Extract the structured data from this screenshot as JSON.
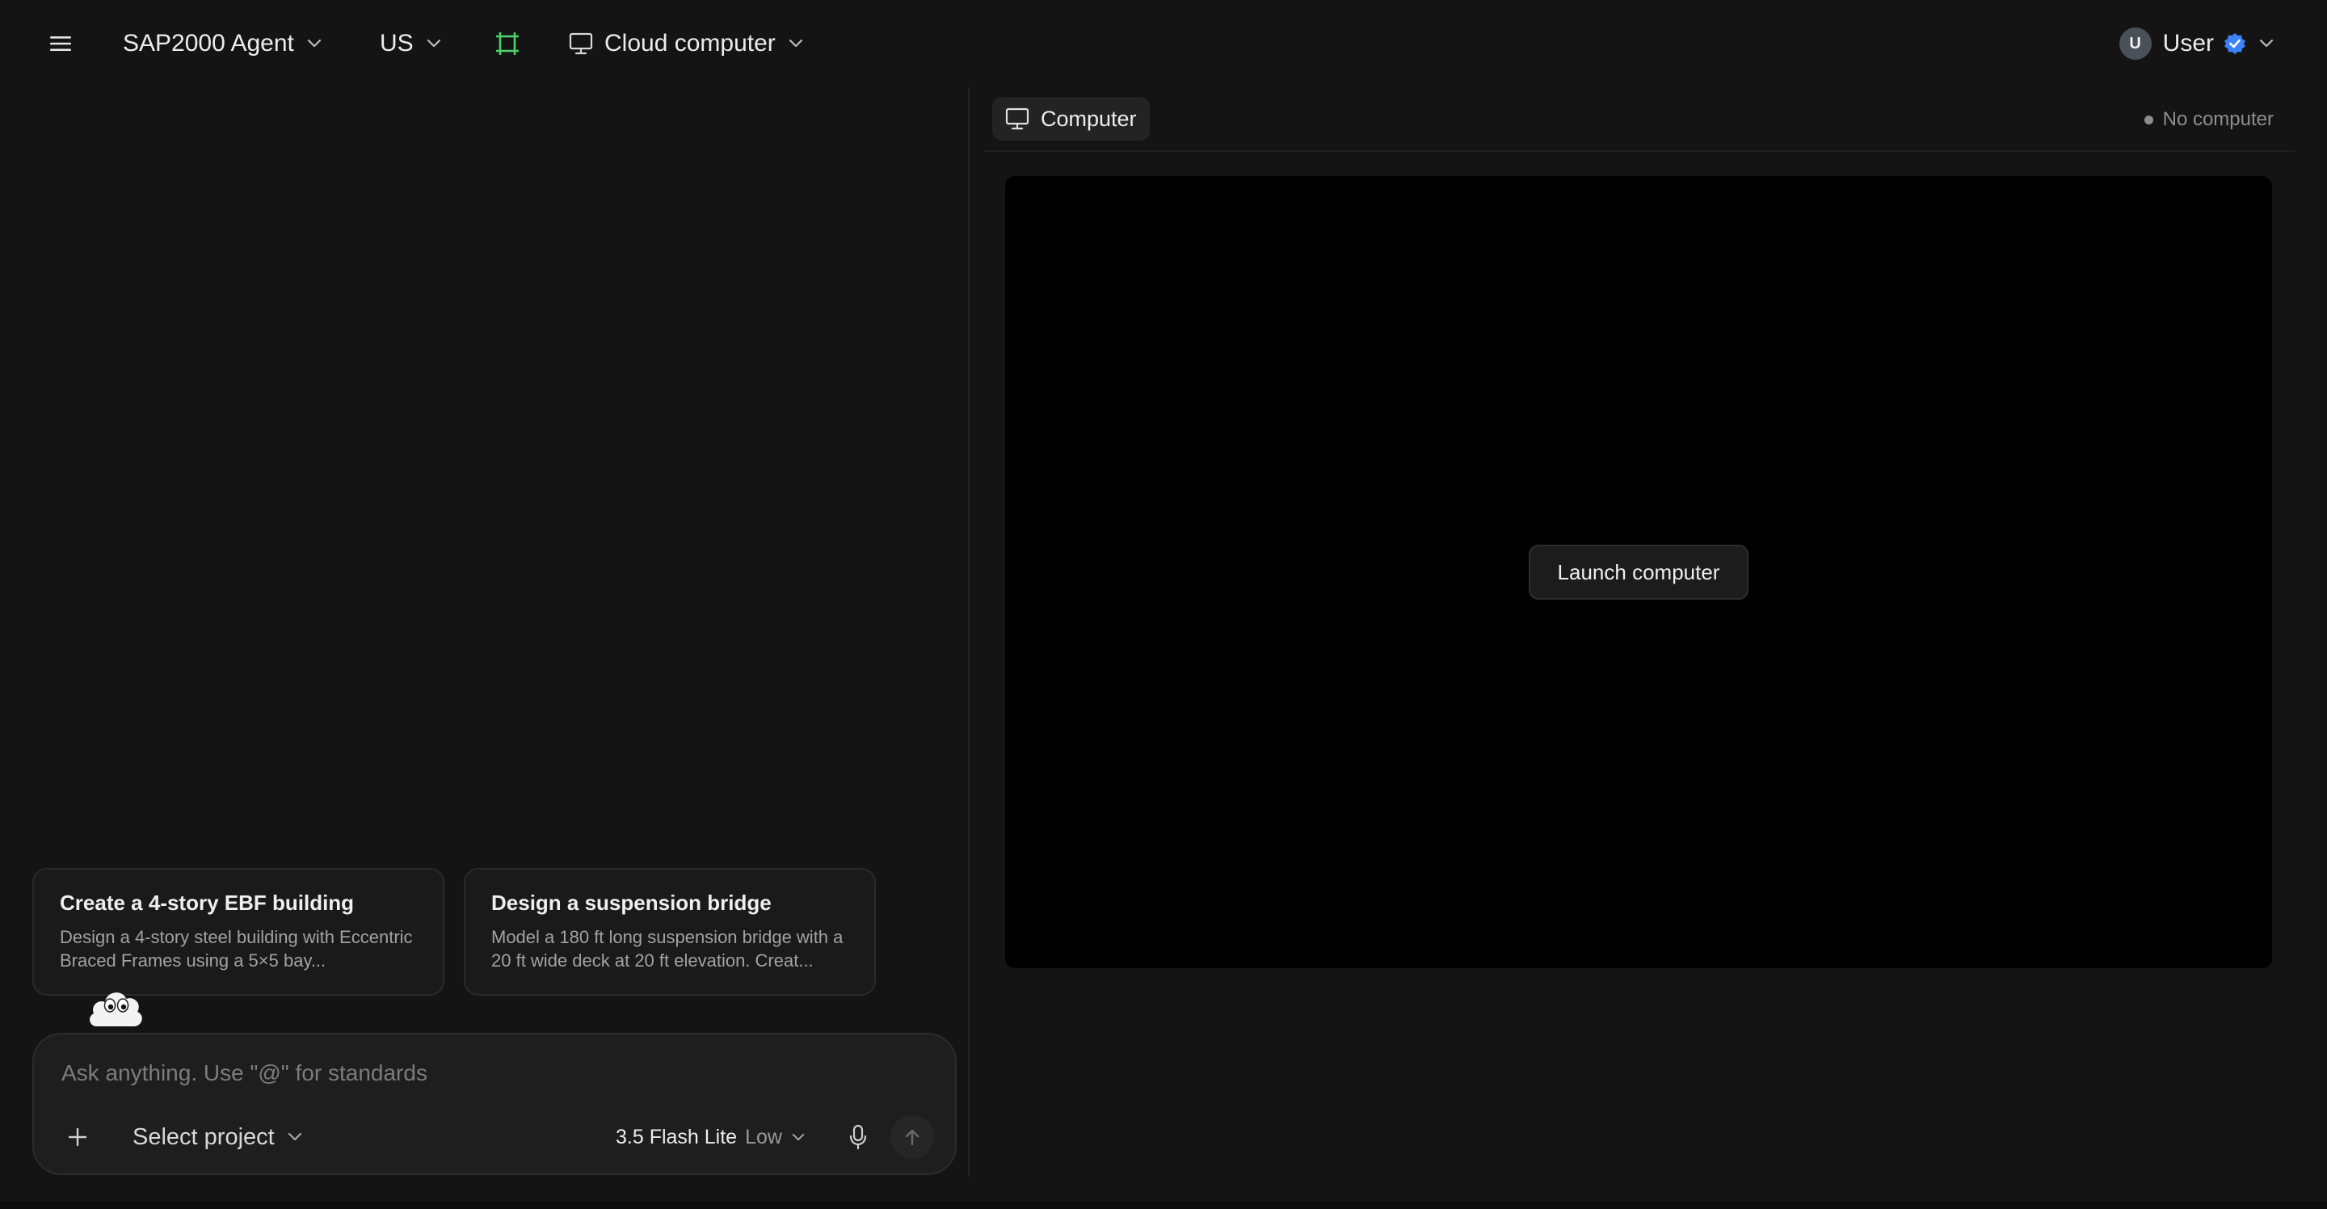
{
  "header": {
    "agent_label": "SAP2000 Agent",
    "region_label": "US",
    "computer_label": "Cloud computer",
    "user": {
      "avatar_initial": "U",
      "name": "User"
    }
  },
  "icons": {
    "menu": "hamburger-icon",
    "frame": "frame-icon",
    "monitor": "monitor-icon",
    "chevron": "chevron-down-icon",
    "verified": "verified-badge-icon",
    "plus": "plus-icon",
    "mic": "microphone-icon",
    "send": "arrow-up-icon",
    "mascot": "cloud-mascot-icon"
  },
  "colors": {
    "background": "#141414",
    "frame_icon": "#4fce6e",
    "verified_badge": "#3b82f6",
    "screen": "#000000"
  },
  "chat": {
    "suggestions": [
      {
        "title": "Create a 4-story EBF building",
        "description": "Design a 4-story steel building with Eccentric Braced Frames using a 5×5 bay..."
      },
      {
        "title": "Design a suspension bridge",
        "description": "Model a 180 ft long suspension bridge with a 20 ft wide deck at 20 ft elevation. Creat..."
      }
    ],
    "composer": {
      "placeholder": "Ask anything. Use \"@\" for standards",
      "value": "",
      "project_label": "Select project",
      "model_name": "3.5 Flash Lite",
      "model_level": "Low"
    }
  },
  "computer_panel": {
    "tab_label": "Computer",
    "status_text": "No computer",
    "launch_label": "Launch computer"
  }
}
